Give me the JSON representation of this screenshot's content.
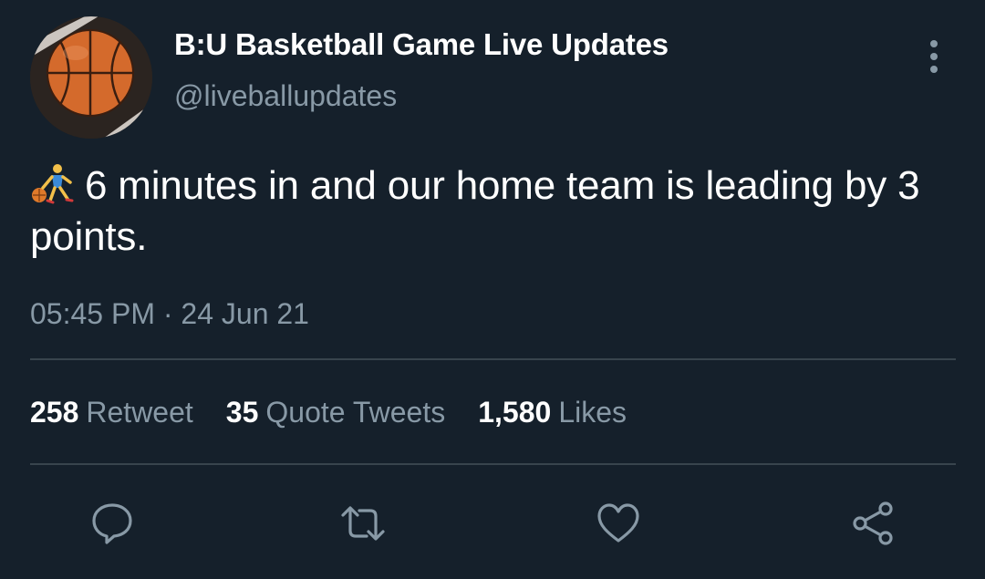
{
  "tweet": {
    "display_name": "B:U Basketball Game Live Updates",
    "handle": "@liveballupdates",
    "text_emoji": "person-bouncing-ball-emoji",
    "text": "6 minutes in and our home team is leading by 3 points.",
    "timestamp": "05:45 PM · 24 Jun 21"
  },
  "stats": {
    "retweets": {
      "count": "258",
      "label": "Retweet"
    },
    "quotes": {
      "count": "35",
      "label": "Quote Tweets"
    },
    "likes": {
      "count": "1,580",
      "label": "Likes"
    }
  },
  "icons": {
    "more": "more-options-icon",
    "reply": "reply-icon",
    "retweet": "retweet-icon",
    "like": "heart-icon",
    "share": "share-icon"
  },
  "colors": {
    "background": "#15202b",
    "primary_text": "#ffffff",
    "secondary_text": "#8899a6",
    "divider": "#38444d"
  }
}
